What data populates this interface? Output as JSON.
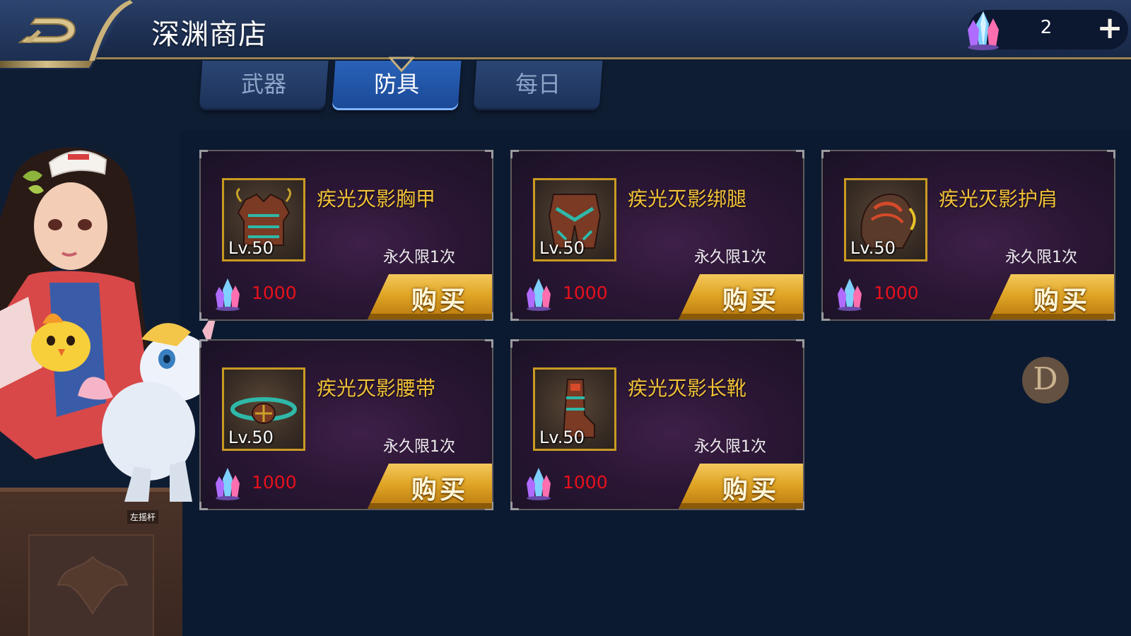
{
  "header": {
    "title": "深渊商店",
    "currency_amount": "2",
    "add_label": "+"
  },
  "tabs": [
    {
      "label": "武器",
      "active": false
    },
    {
      "label": "防具",
      "active": true
    },
    {
      "label": "每日",
      "active": false
    }
  ],
  "items": [
    {
      "name": "疾光灭影胸甲",
      "level": "Lv.50",
      "limit": "永久限1次",
      "price": "1000",
      "buy_label": "购买",
      "icon": "chest-armor-icon"
    },
    {
      "name": "疾光灭影绑腿",
      "level": "Lv.50",
      "limit": "永久限1次",
      "price": "1000",
      "buy_label": "购买",
      "icon": "leg-armor-icon"
    },
    {
      "name": "疾光灭影护肩",
      "level": "Lv.50",
      "limit": "永久限1次",
      "price": "1000",
      "buy_label": "购买",
      "icon": "shoulder-armor-icon"
    },
    {
      "name": "疾光灭影腰带",
      "level": "Lv.50",
      "limit": "永久限1次",
      "price": "1000",
      "buy_label": "购买",
      "icon": "belt-icon"
    },
    {
      "name": "疾光灭影长靴",
      "level": "Lv.50",
      "limit": "永久限1次",
      "price": "1000",
      "buy_label": "购买",
      "icon": "boots-icon"
    }
  ],
  "joystick_label": "左摇杆",
  "floating_button_label": "D",
  "colors": {
    "item_name": "#f2c13a",
    "price": "#e8101c",
    "active_tab": "#2a62b8",
    "buy_button": "#e0a626"
  }
}
